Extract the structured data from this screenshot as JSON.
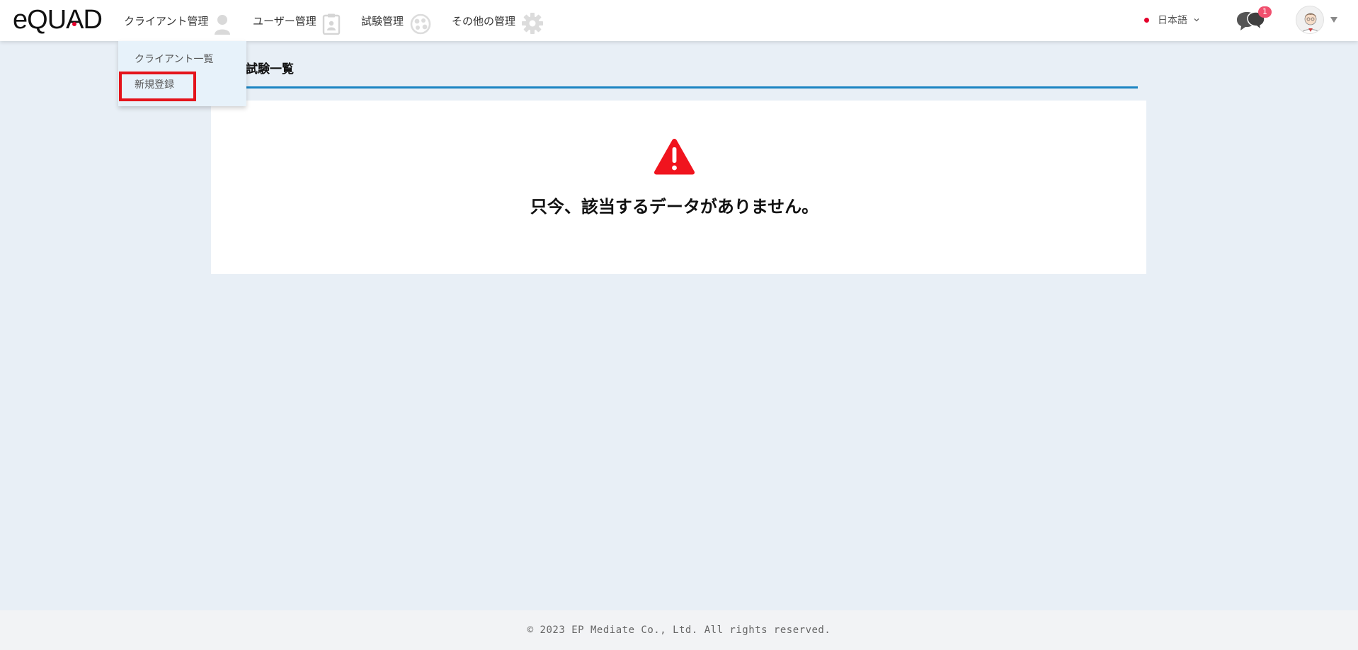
{
  "brand": {
    "logo_text_1": "eQU",
    "logo_text_2": "A",
    "logo_text_3": "D",
    "accent": "#e4002b"
  },
  "nav": {
    "client": {
      "label": "クライアント管理",
      "icon": "person-icon"
    },
    "user": {
      "label": "ユーザー管理",
      "icon": "clipboard-user-icon"
    },
    "exam": {
      "label": "試験管理",
      "icon": "exam-icon"
    },
    "other": {
      "label": "その他の管理",
      "icon": "gear-icon"
    }
  },
  "language": {
    "label": "日本語",
    "icon": "japan-flag-icon"
  },
  "chat": {
    "badge": "1",
    "icon": "chat-bubbles-icon"
  },
  "user_menu": {
    "icon": "user-avatar-icon"
  },
  "dropdown": {
    "items": [
      {
        "label": "クライアント一覧"
      },
      {
        "label": "新規登録",
        "highlighted": true
      }
    ],
    "highlight_color": "#e4141b"
  },
  "main": {
    "section_title": "の試験一覧",
    "empty_message": "只今、該当するデータがありません。",
    "warning_icon": "warning-triangle-icon",
    "warning_color": "#f0141e",
    "rule_color": "#1b84c2"
  },
  "footer": {
    "copyright": "© 2023 EP Mediate Co., Ltd. All rights reserved."
  }
}
